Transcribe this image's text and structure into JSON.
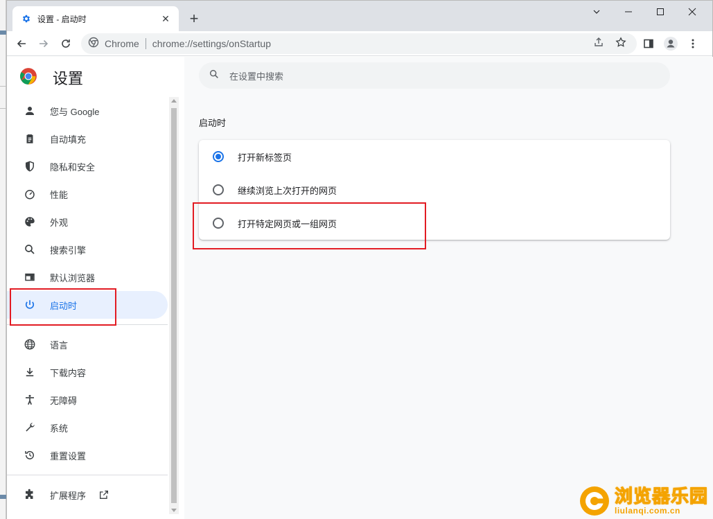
{
  "tab": {
    "title": "设置 - 启动时",
    "close": "✕",
    "new_tab": "+"
  },
  "window_controls": {
    "minimize": "—",
    "maximize": "☐",
    "close": "✕"
  },
  "omnibox": {
    "site_label": "Chrome",
    "url": "chrome://settings/onStartup"
  },
  "sidebar": {
    "title": "设置",
    "items": [
      {
        "label": "您与 Google",
        "icon": "person-icon"
      },
      {
        "label": "自动填充",
        "icon": "clipboard-icon"
      },
      {
        "label": "隐私和安全",
        "icon": "shield-icon"
      },
      {
        "label": "性能",
        "icon": "speedometer-icon"
      },
      {
        "label": "外观",
        "icon": "palette-icon"
      },
      {
        "label": "搜索引擎",
        "icon": "search-icon"
      },
      {
        "label": "默认浏览器",
        "icon": "browser-window-icon"
      },
      {
        "label": "启动时",
        "icon": "power-icon",
        "active": true
      }
    ],
    "items2": [
      {
        "label": "语言",
        "icon": "globe-icon"
      },
      {
        "label": "下载内容",
        "icon": "download-icon"
      },
      {
        "label": "无障碍",
        "icon": "accessibility-icon"
      },
      {
        "label": "系统",
        "icon": "wrench-icon"
      },
      {
        "label": "重置设置",
        "icon": "restore-icon"
      }
    ],
    "extensions": {
      "label": "扩展程序",
      "icon": "puzzle-icon"
    }
  },
  "search": {
    "placeholder": "在设置中搜索"
  },
  "startup": {
    "section_title": "启动时",
    "options": [
      {
        "label": "打开新标签页",
        "checked": true
      },
      {
        "label": "继续浏览上次打开的网页",
        "checked": false
      },
      {
        "label": "打开特定网页或一组网页",
        "checked": false
      }
    ]
  },
  "colors": {
    "accent": "#1a73e8",
    "highlight": "#e21b23",
    "watermark": "#f4a300"
  },
  "watermark": {
    "cn": "浏览器乐园",
    "en": "liulanqi.com.cn"
  }
}
